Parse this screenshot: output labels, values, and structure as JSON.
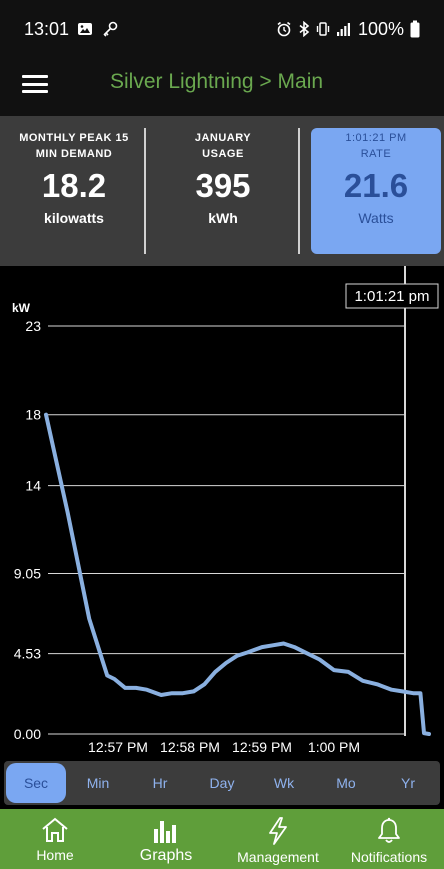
{
  "status_bar": {
    "time": "13:01",
    "battery": "100%",
    "icons": [
      "image-icon",
      "key-icon",
      "alarm-icon",
      "bluetooth-icon",
      "vibrate-icon",
      "signal-icon",
      "battery-icon"
    ]
  },
  "app_bar": {
    "title": "Silver Lightning > Main",
    "menu_icon": "hamburger-menu-icon"
  },
  "stats": {
    "peak": {
      "caption_line1": "MONTHLY PEAK 15",
      "caption_line2": "MIN DEMAND",
      "value": "18.2",
      "unit": "kilowatts"
    },
    "usage": {
      "caption_line1": "JANUARY",
      "caption_line2": "USAGE",
      "value": "395",
      "unit": "kWh"
    },
    "rate": {
      "caption_line1": "1:01:21 PM",
      "caption_line2": "RATE",
      "value": "21.6",
      "unit": "Watts"
    }
  },
  "chart_data": {
    "type": "line",
    "ylabel": "kW",
    "y_ticks": [
      "0.00",
      "4.53",
      "9.05",
      "14",
      "18",
      "23"
    ],
    "y_tick_values": [
      0,
      4.53,
      9.05,
      14,
      18,
      23
    ],
    "ylim": [
      0,
      23
    ],
    "x_ticks": [
      "12:57 PM",
      "12:58 PM",
      "12:59 PM",
      "1:00 PM"
    ],
    "cursor_label": "1:01:21 pm",
    "line_color": "#8ab0e0",
    "grid": true,
    "series": [
      {
        "x_minutes_after_1256": [
          0.0,
          0.3,
          0.6,
          0.85,
          0.95,
          1.1,
          1.25,
          1.4,
          1.6,
          1.75,
          1.9,
          2.05,
          2.2,
          2.35,
          2.5,
          2.65,
          2.8,
          3.0,
          3.15,
          3.3,
          3.45,
          3.6,
          3.8,
          4.0,
          4.2,
          4.4,
          4.6,
          4.8,
          4.95,
          5.1,
          5.2,
          5.25,
          5.32
        ],
        "y": [
          18.0,
          12.5,
          6.5,
          3.3,
          3.1,
          2.6,
          2.6,
          2.5,
          2.2,
          2.3,
          2.3,
          2.4,
          2.8,
          3.5,
          4.0,
          4.4,
          4.6,
          4.9,
          5.0,
          5.1,
          4.9,
          4.6,
          4.2,
          3.6,
          3.5,
          3.0,
          2.8,
          2.5,
          2.4,
          2.3,
          2.3,
          0.05,
          0.0
        ]
      }
    ]
  },
  "range_tabs": [
    "Sec",
    "Min",
    "Hr",
    "Day",
    "Wk",
    "Mo",
    "Yr"
  ],
  "active_range": "Sec",
  "bottom_nav": {
    "items": [
      {
        "label": "Home",
        "icon": "home-icon"
      },
      {
        "label": "Graphs",
        "icon": "bar-chart-icon"
      },
      {
        "label": "Management",
        "icon": "lightning-icon"
      },
      {
        "label": "Notifications",
        "icon": "bell-icon"
      }
    ],
    "active": "Graphs"
  },
  "colors": {
    "accent_green": "#5f9e3a",
    "title_green": "#6aa84f",
    "rate_tile": "#7aa7f2",
    "rate_text": "#2a4f99"
  }
}
